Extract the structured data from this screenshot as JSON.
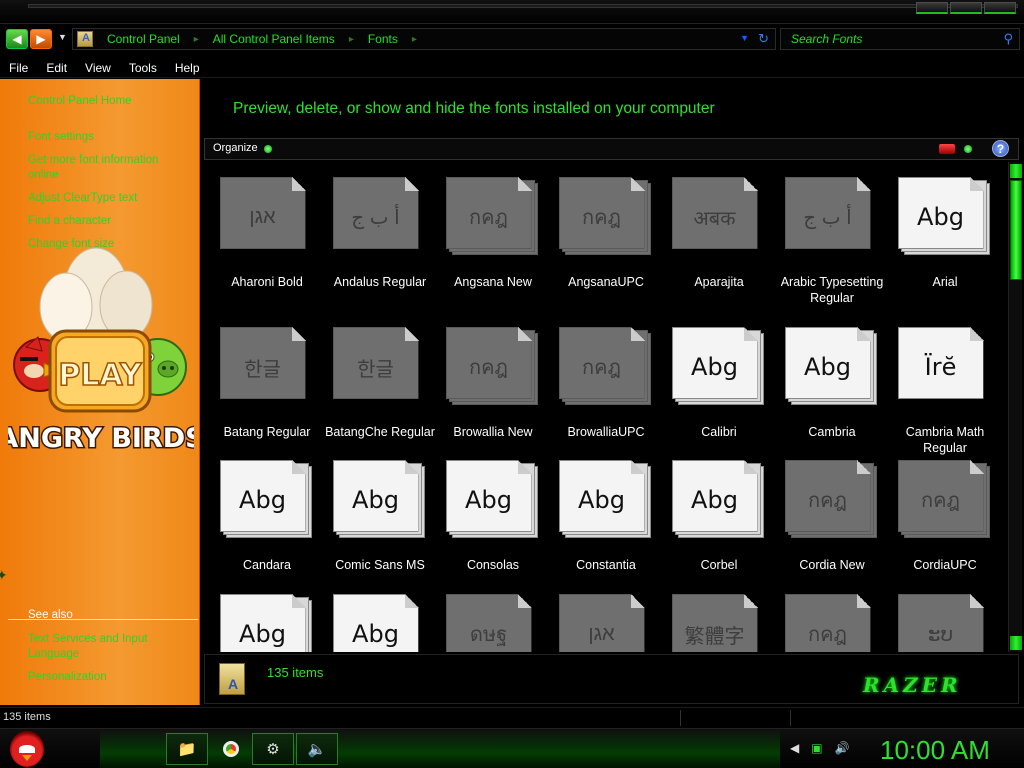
{
  "window": {
    "buttons": [
      "minimize",
      "maximize",
      "close"
    ]
  },
  "address": {
    "breadcrumbs": [
      "Control Panel",
      "All Control Panel Items",
      "Fonts"
    ],
    "search_placeholder": "Search Fonts"
  },
  "menu": [
    "File",
    "Edit",
    "View",
    "Tools",
    "Help"
  ],
  "sidebar": {
    "links": [
      "Control Panel Home",
      "Font settings",
      "Get more font information online",
      "Adjust ClearType text",
      "Find a character",
      "Change font size"
    ],
    "see_also_label": "See also",
    "see_also_links": [
      "Text Services and Input Language",
      "Personalization"
    ],
    "art": {
      "play_text": "PLAY",
      "game_title": "ANGRY BIRDS"
    }
  },
  "content": {
    "heading": "Preview, delete, or show and hide the fonts installed on your computer",
    "organize_label": "Organize"
  },
  "fonts": [
    {
      "name": "Aharoni Bold",
      "sample": "אגן",
      "style": "gray",
      "stack": false
    },
    {
      "name": "Andalus Regular",
      "sample": "أ ب ج",
      "style": "gray",
      "stack": false
    },
    {
      "name": "Angsana New",
      "sample": "กคฎ",
      "style": "gray",
      "stack": true
    },
    {
      "name": "AngsanaUPC",
      "sample": "กคฎ",
      "style": "gray",
      "stack": true
    },
    {
      "name": "Aparajita",
      "sample": "अबक",
      "style": "gray",
      "stack": false
    },
    {
      "name": "Arabic Typesetting Regular",
      "sample": "أ ب ج",
      "style": "gray",
      "stack": false
    },
    {
      "name": "Arial",
      "sample": "Abg",
      "style": "white",
      "stack": true
    },
    {
      "name": "Batang Regular",
      "sample": "한글",
      "style": "gray",
      "stack": false
    },
    {
      "name": "BatangChe Regular",
      "sample": "한글",
      "style": "gray",
      "stack": false
    },
    {
      "name": "Browallia New",
      "sample": "กคฎ",
      "style": "gray",
      "stack": true
    },
    {
      "name": "BrowalliaUPC",
      "sample": "กคฎ",
      "style": "gray",
      "stack": true
    },
    {
      "name": "Calibri",
      "sample": "Abg",
      "style": "white",
      "stack": true
    },
    {
      "name": "Cambria",
      "sample": "Abg",
      "style": "white",
      "stack": true
    },
    {
      "name": "Cambria Math Regular",
      "sample": "Ïrĕ",
      "style": "white",
      "stack": false
    },
    {
      "name": "Candara",
      "sample": "Abg",
      "style": "white",
      "stack": true
    },
    {
      "name": "Comic Sans MS",
      "sample": "Abg",
      "style": "white",
      "stack": true
    },
    {
      "name": "Consolas",
      "sample": "Abg",
      "style": "white",
      "stack": true
    },
    {
      "name": "Constantia",
      "sample": "Abg",
      "style": "white",
      "stack": true
    },
    {
      "name": "Corbel",
      "sample": "Abg",
      "style": "white",
      "stack": true
    },
    {
      "name": "Cordia New",
      "sample": "กคฎ",
      "style": "gray",
      "stack": true
    },
    {
      "name": "CordiaUPC",
      "sample": "กคฎ",
      "style": "gray",
      "stack": true
    },
    {
      "name": "",
      "sample": "Abg",
      "style": "white",
      "stack": true
    },
    {
      "name": "",
      "sample": "Abg",
      "style": "white",
      "stack": false
    },
    {
      "name": "",
      "sample": "ดษฐ",
      "style": "gray",
      "stack": false
    },
    {
      "name": "",
      "sample": "אגן",
      "style": "gray",
      "stack": false
    },
    {
      "name": "",
      "sample": "繁體字",
      "style": "gray",
      "stack": false
    },
    {
      "name": "",
      "sample": "กคฎ",
      "style": "gray",
      "stack": false
    },
    {
      "name": "",
      "sample": "ະບ",
      "style": "gray",
      "stack": false
    }
  ],
  "details": {
    "item_count": "135 items",
    "brand_logo": "RAZER"
  },
  "status": {
    "text": "135 items"
  },
  "taskbar": {
    "apps": [
      "folder-icon",
      "chrome-icon",
      "media-icon",
      "volume-app-icon"
    ],
    "clock": "10:00 AM"
  },
  "colors": {
    "accent": "#2fe02f",
    "sidebar": "#f07a0a",
    "background": "#000000"
  }
}
